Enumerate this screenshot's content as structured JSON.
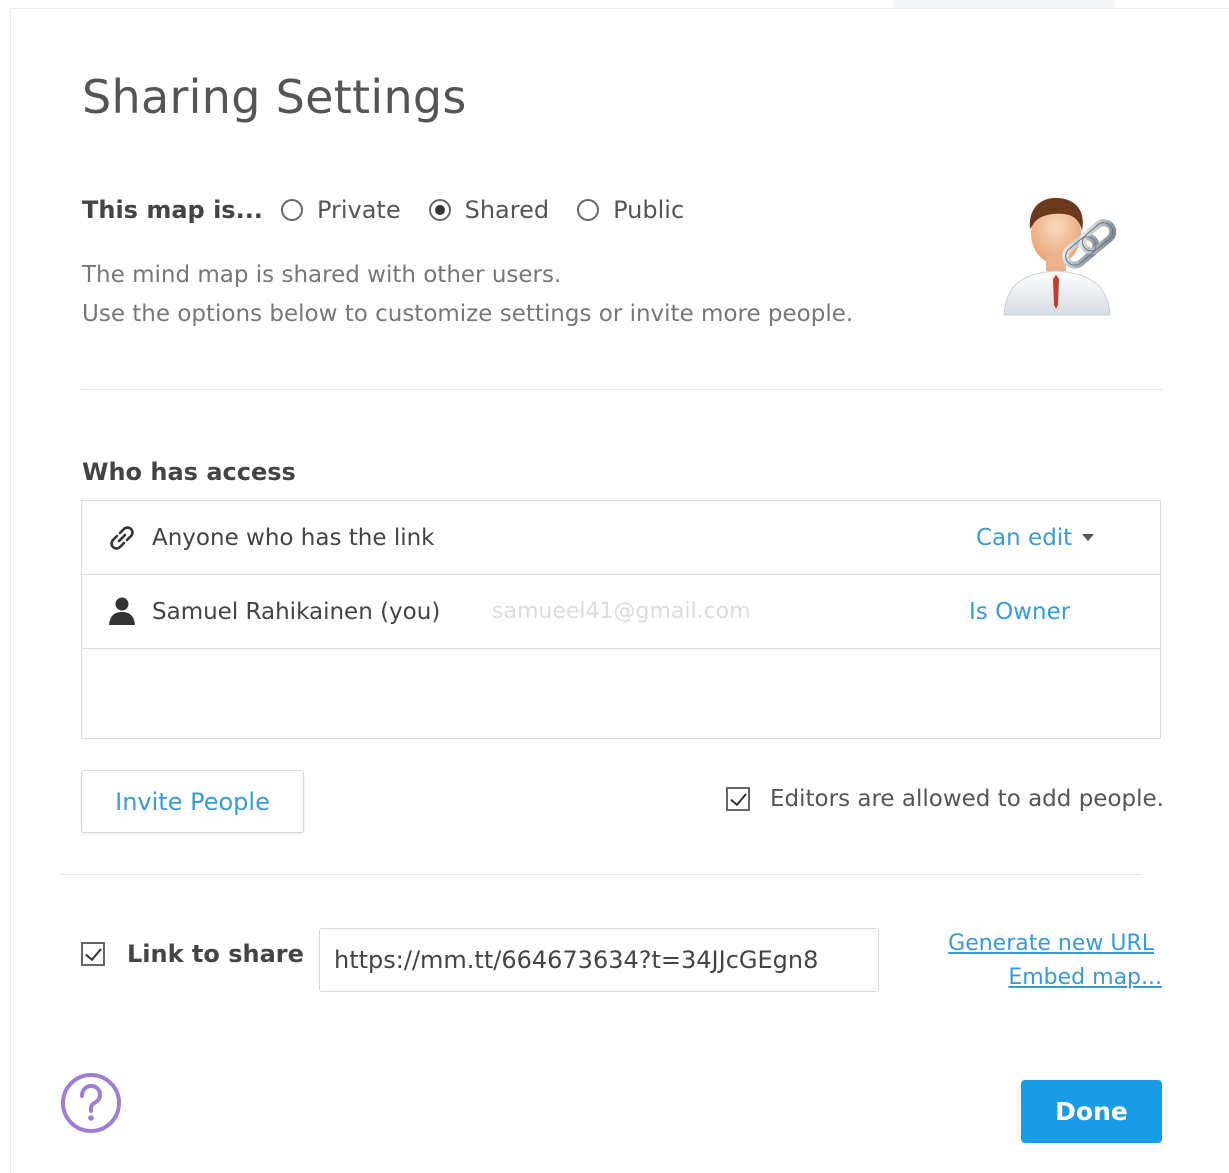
{
  "dialog": {
    "title": "Sharing Settings"
  },
  "privacy": {
    "label": "This map is...",
    "options": [
      {
        "label": "Private",
        "checked": false
      },
      {
        "label": "Shared",
        "checked": true
      },
      {
        "label": "Public",
        "checked": false
      }
    ],
    "description_line1": "The mind map is shared with other users.",
    "description_line2": "Use the options below to customize settings or invite more people."
  },
  "access": {
    "title": "Who has access",
    "rows": [
      {
        "icon": "link-icon",
        "name": "Anyone who has the link",
        "email": "",
        "permission": "Can edit"
      },
      {
        "icon": "user-icon",
        "name": "Samuel Rahikainen (you)",
        "email": "samueel41@gmail.com",
        "permission": "Is Owner"
      }
    ]
  },
  "invite": {
    "button_label": "Invite People",
    "editors_checkbox_label": "Editors are allowed to add people.",
    "editors_checked": true
  },
  "share_link": {
    "checkbox_label": "Link to share",
    "checked": true,
    "url": "https://mm.tt/664673634?t=34JJcGEgn8",
    "generate_label": "Generate new URL",
    "embed_label": "Embed map..."
  },
  "footer": {
    "done_label": "Done",
    "help_icon": "question-circle-icon"
  },
  "colors": {
    "accent": "#3a9ad9",
    "primary_button": "#1a9be6",
    "help_icon": "#9b7fd6"
  }
}
